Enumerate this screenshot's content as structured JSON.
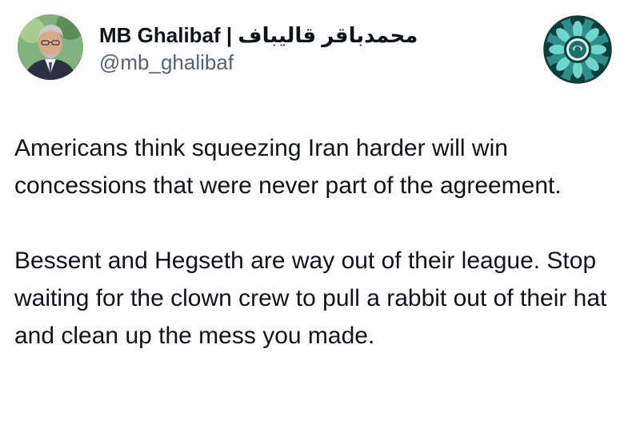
{
  "author": {
    "display_name": "MB Ghalibaf | محمدباقر قالیباف",
    "handle": "@mb_ghalibaf",
    "avatar_icon": "person-portrait-avatar",
    "badge_icon": "circular-emblem-icon"
  },
  "tweet": {
    "paragraphs": [
      "Americans think squeezing Iran harder will win concessions that were never part of the agreement.",
      "Bessent and Hegseth are way out of their league. Stop waiting for the clown crew to pull a rabbit out of their hat and clean up the mess you made."
    ]
  },
  "colors": {
    "text": "#0f1419",
    "secondary_text": "#536471",
    "emblem_teal": "#4fc7bc",
    "emblem_dark": "#0e3d3a"
  }
}
